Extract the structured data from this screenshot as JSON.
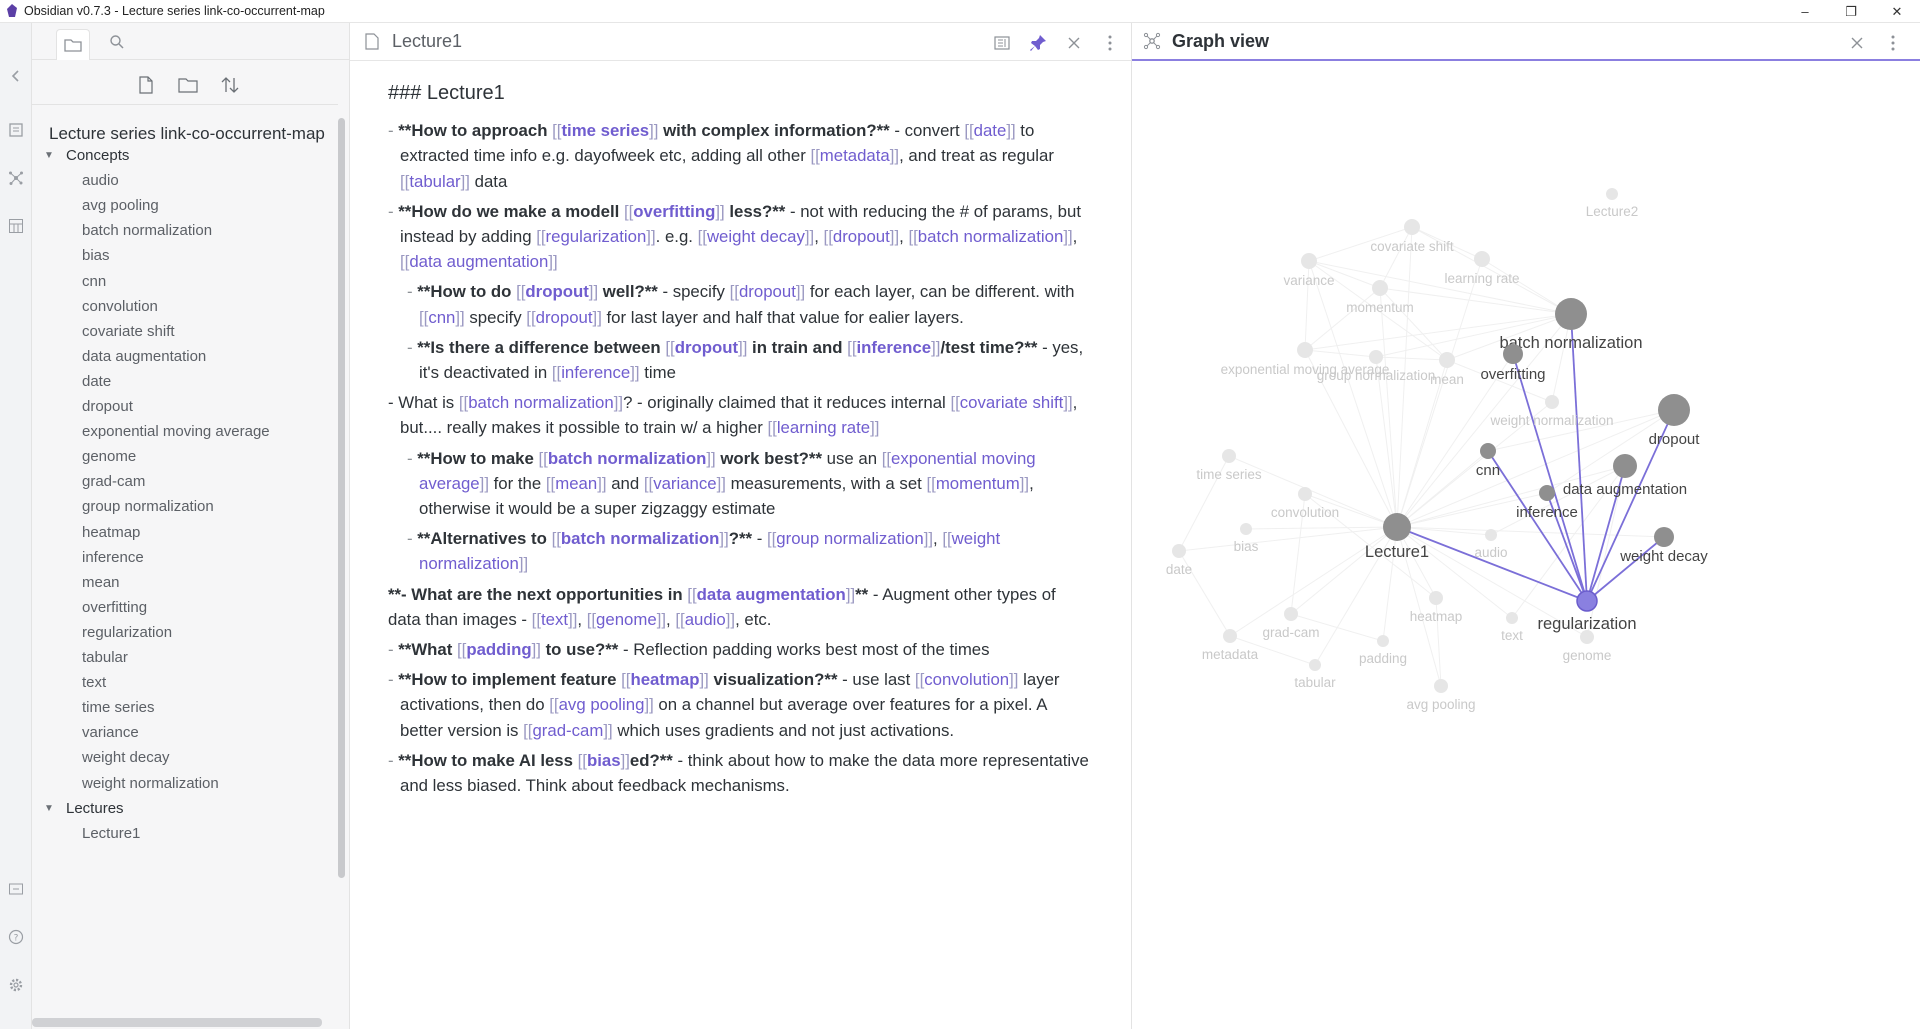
{
  "window": {
    "title": "Obsidian v0.7.3 - Lecture series link-co-occurrent-map",
    "controls": {
      "minimize": "–",
      "restore": "❐",
      "close": "✕"
    }
  },
  "ribbon": {
    "icons": [
      "collapse-icon",
      "open-quick-switcher-icon",
      "graph-icon",
      "templates-icon",
      "import-icon",
      "help-icon",
      "settings-icon"
    ]
  },
  "sidebar": {
    "tabs": [
      "file-explorer-icon",
      "search-icon"
    ],
    "actions": [
      "new-note-icon",
      "new-folder-icon",
      "sort-icon"
    ],
    "vault_name": "Lecture series link-co-occurrent-map",
    "folders": [
      {
        "name": "Concepts",
        "expanded": true,
        "files": [
          "audio",
          "avg pooling",
          "batch normalization",
          "bias",
          "cnn",
          "convolution",
          "covariate shift",
          "data augmentation",
          "date",
          "dropout",
          "exponential moving average",
          "genome",
          "grad-cam",
          "group normalization",
          "heatmap",
          "inference",
          "mean",
          "overfitting",
          "regularization",
          "tabular",
          "text",
          "time series",
          "variance",
          "weight decay",
          "weight normalization"
        ]
      },
      {
        "name": "Lectures",
        "expanded": true,
        "files": [
          "Lecture1"
        ]
      }
    ]
  },
  "editor": {
    "title": "Lecture1",
    "heading": "### Lecture1",
    "lines": [
      {
        "level": 1,
        "parts": [
          [
            "t",
            "- "
          ],
          [
            "b",
            "**How to approach "
          ],
          [
            "bl",
            "[["
          ],
          [
            "lb",
            "time series"
          ],
          [
            "bl",
            "]]"
          ],
          [
            "b",
            " with complex information?**"
          ],
          [
            "t",
            " - convert "
          ],
          [
            "bl",
            "[["
          ],
          [
            "l",
            "date"
          ],
          [
            "bl",
            "]]"
          ],
          [
            "t",
            " to extracted time info e.g. dayofweek etc, adding all other "
          ],
          [
            "bl",
            "[["
          ],
          [
            "l",
            "metadata"
          ],
          [
            "bl",
            "]]"
          ],
          [
            "t",
            ", and treat as regular "
          ],
          [
            "bl",
            "[["
          ],
          [
            "l",
            "tabular"
          ],
          [
            "bl",
            "]]"
          ],
          [
            "t",
            " data"
          ]
        ]
      },
      {
        "level": 1,
        "parts": [
          [
            "t",
            "- "
          ],
          [
            "b",
            "**How do we make a modell "
          ],
          [
            "bl",
            "[["
          ],
          [
            "lb",
            "overfitting"
          ],
          [
            "bl",
            "]]"
          ],
          [
            "b",
            " less?**"
          ],
          [
            "t",
            " - not with reducing the # of params, but instead by adding "
          ],
          [
            "bl",
            "[["
          ],
          [
            "l",
            "regularization"
          ],
          [
            "bl",
            "]]"
          ],
          [
            "t",
            ". e.g. "
          ],
          [
            "bl",
            "[["
          ],
          [
            "l",
            "weight decay"
          ],
          [
            "bl",
            "]]"
          ],
          [
            "t",
            ", "
          ],
          [
            "bl",
            "[["
          ],
          [
            "l",
            "dropout"
          ],
          [
            "bl",
            "]]"
          ],
          [
            "t",
            ", "
          ],
          [
            "bl",
            "[["
          ],
          [
            "l",
            "batch normalization"
          ],
          [
            "bl",
            "]]"
          ],
          [
            "t",
            ", "
          ],
          [
            "bl",
            "[["
          ],
          [
            "l",
            "data augmentation"
          ],
          [
            "bl",
            "]]"
          ]
        ]
      },
      {
        "level": 2,
        "parts": [
          [
            "t",
            "- "
          ],
          [
            "b",
            "**How to do "
          ],
          [
            "bl",
            "[["
          ],
          [
            "lb",
            "dropout"
          ],
          [
            "bl",
            "]]"
          ],
          [
            "b",
            " well?**"
          ],
          [
            "t",
            " - specify "
          ],
          [
            "bl",
            "[["
          ],
          [
            "l",
            "dropout"
          ],
          [
            "bl",
            "]]"
          ],
          [
            "t",
            " for each layer, can be different. with "
          ],
          [
            "bl",
            "[["
          ],
          [
            "l",
            "cnn"
          ],
          [
            "bl",
            "]]"
          ],
          [
            "t",
            " specify "
          ],
          [
            "bl",
            "[["
          ],
          [
            "l",
            "dropout"
          ],
          [
            "bl",
            "]]"
          ],
          [
            "t",
            " for last layer and half that value for ealier layers."
          ]
        ]
      },
      {
        "level": 2,
        "parts": [
          [
            "t",
            "- "
          ],
          [
            "b",
            "**Is there a difference between "
          ],
          [
            "bl",
            "[["
          ],
          [
            "lb",
            "dropout"
          ],
          [
            "bl",
            "]]"
          ],
          [
            "b",
            " in train and "
          ],
          [
            "bl",
            "[["
          ],
          [
            "lb",
            "inference"
          ],
          [
            "bl",
            "]]"
          ],
          [
            "b",
            "/test time?**"
          ],
          [
            "t",
            " - yes, it's deactivated in "
          ],
          [
            "bl",
            "[["
          ],
          [
            "l",
            "inference"
          ],
          [
            "bl",
            "]]"
          ],
          [
            "t",
            " time"
          ]
        ]
      },
      {
        "level": 1,
        "parts": [
          [
            "t",
            "- What is "
          ],
          [
            "bl",
            "[["
          ],
          [
            "l",
            "batch normalization"
          ],
          [
            "bl",
            "]]"
          ],
          [
            "t",
            "? - originally claimed that it reduces internal "
          ],
          [
            "bl",
            "[["
          ],
          [
            "l",
            "covariate shift"
          ],
          [
            "bl",
            "]]"
          ],
          [
            "t",
            ", but.... really makes it possible to train w/ a higher "
          ],
          [
            "bl",
            "[["
          ],
          [
            "l",
            "learning rate"
          ],
          [
            "bl",
            "]]"
          ]
        ]
      },
      {
        "level": 2,
        "parts": [
          [
            "t",
            "- "
          ],
          [
            "b",
            "**How to make "
          ],
          [
            "bl",
            "[["
          ],
          [
            "lb",
            "batch normalization"
          ],
          [
            "bl",
            "]]"
          ],
          [
            "b",
            " work best?**"
          ],
          [
            "t",
            " use an "
          ],
          [
            "bl",
            "[["
          ],
          [
            "l",
            "exponential moving average"
          ],
          [
            "bl",
            "]]"
          ],
          [
            "t",
            " for the "
          ],
          [
            "bl",
            "[["
          ],
          [
            "l",
            "mean"
          ],
          [
            "bl",
            "]]"
          ],
          [
            "t",
            " and "
          ],
          [
            "bl",
            "[["
          ],
          [
            "l",
            "variance"
          ],
          [
            "bl",
            "]]"
          ],
          [
            "t",
            " measurements, with a set "
          ],
          [
            "bl",
            "[["
          ],
          [
            "l",
            "momentum"
          ],
          [
            "bl",
            "]]"
          ],
          [
            "t",
            ", otherwise it would be a super zigzaggy estimate"
          ]
        ]
      },
      {
        "level": 2,
        "parts": [
          [
            "t",
            "- "
          ],
          [
            "b",
            "**Alternatives to "
          ],
          [
            "bl",
            "[["
          ],
          [
            "lb",
            "batch normalization"
          ],
          [
            "bl",
            "]]"
          ],
          [
            "b",
            "?**"
          ],
          [
            "t",
            " - "
          ],
          [
            "bl",
            "[["
          ],
          [
            "l",
            "group normalization"
          ],
          [
            "bl",
            "]]"
          ],
          [
            "t",
            ", "
          ],
          [
            "bl",
            "[["
          ],
          [
            "l",
            "weight normalization"
          ],
          [
            "bl",
            "]]"
          ]
        ]
      },
      {
        "level": 0,
        "parts": [
          [
            "b",
            "**- What are the next opportunities in "
          ],
          [
            "bl",
            "[["
          ],
          [
            "lb",
            "data augmentation"
          ],
          [
            "bl",
            "]]"
          ],
          [
            "b",
            "**"
          ],
          [
            "t",
            " - Augment other types of data than images - "
          ],
          [
            "bl",
            "[["
          ],
          [
            "l",
            "text"
          ],
          [
            "bl",
            "]]"
          ],
          [
            "t",
            ", "
          ],
          [
            "bl",
            "[["
          ],
          [
            "l",
            "genome"
          ],
          [
            "bl",
            "]]"
          ],
          [
            "t",
            ", "
          ],
          [
            "bl",
            "[["
          ],
          [
            "l",
            "audio"
          ],
          [
            "bl",
            "]]"
          ],
          [
            "t",
            ", etc."
          ]
        ]
      },
      {
        "level": 1,
        "parts": [
          [
            "t",
            "- "
          ],
          [
            "b",
            "**What "
          ],
          [
            "bl",
            "[["
          ],
          [
            "lb",
            "padding"
          ],
          [
            "bl",
            "]]"
          ],
          [
            "b",
            " to use?**"
          ],
          [
            "t",
            " - Reflection padding works best most of the times"
          ]
        ]
      },
      {
        "level": 1,
        "parts": [
          [
            "t",
            "- "
          ],
          [
            "b",
            "**How to implement feature "
          ],
          [
            "bl",
            "[["
          ],
          [
            "lb",
            "heatmap"
          ],
          [
            "bl",
            "]]"
          ],
          [
            "b",
            " visualization?**"
          ],
          [
            "t",
            " - use last "
          ],
          [
            "bl",
            "[["
          ],
          [
            "l",
            "convolution"
          ],
          [
            "bl",
            "]]"
          ],
          [
            "t",
            " layer activations, then do "
          ],
          [
            "bl",
            "[["
          ],
          [
            "l",
            "avg pooling"
          ],
          [
            "bl",
            "]]"
          ],
          [
            "t",
            " on a channel but average over features for a pixel. A better version is "
          ],
          [
            "bl",
            "[["
          ],
          [
            "l",
            "grad-cam"
          ],
          [
            "bl",
            "]]"
          ],
          [
            "t",
            " which uses gradients and not just activations."
          ]
        ]
      },
      {
        "level": 1,
        "parts": [
          [
            "t",
            "- "
          ],
          [
            "b",
            "**How to make AI less "
          ],
          [
            "bl",
            "[["
          ],
          [
            "lb",
            "bias"
          ],
          [
            "bl",
            "]]"
          ],
          [
            "b",
            "ed?**"
          ],
          [
            "t",
            " - think about how to make the data more representative and less biased. Think about feedback mechanisms."
          ]
        ]
      }
    ],
    "actions": [
      "preview-toggle-icon",
      "pin-icon",
      "close-icon",
      "more-options-icon"
    ]
  },
  "graph": {
    "title": "Graph view",
    "actions": [
      "close-icon",
      "more-options-icon"
    ],
    "colors": {
      "highlight": "#7b6fd8",
      "active_node": "#8a80e0",
      "node": "#8f8f8f",
      "faded_node": "#e6e6e6",
      "faded_edge": "#f0f0f0",
      "label": "#444444",
      "faded_label": "#c9c9c9"
    },
    "nodes": [
      {
        "id": "regularization",
        "label": "regularization",
        "state": "active"
      },
      {
        "id": "Lecture1",
        "label": "Lecture1",
        "state": "neighbor"
      },
      {
        "id": "batch normalization",
        "label": "batch normalization",
        "state": "neighbor"
      },
      {
        "id": "dropout",
        "label": "dropout",
        "state": "neighbor"
      },
      {
        "id": "overfitting",
        "label": "overfitting",
        "state": "neighbor"
      },
      {
        "id": "data augmentation",
        "label": "data augmentation",
        "state": "neighbor"
      },
      {
        "id": "weight decay",
        "label": "weight decay",
        "state": "neighbor"
      },
      {
        "id": "cnn",
        "label": "cnn",
        "state": "neighbor"
      },
      {
        "id": "inference",
        "label": "inference",
        "state": "neighbor"
      },
      {
        "id": "Lecture2",
        "label": "Lecture2",
        "state": "faded"
      },
      {
        "id": "covariate shift",
        "label": "covariate shift",
        "state": "faded"
      },
      {
        "id": "learning rate",
        "label": "learning rate",
        "state": "faded"
      },
      {
        "id": "variance",
        "label": "variance",
        "state": "faded"
      },
      {
        "id": "momentum",
        "label": "momentum",
        "state": "faded"
      },
      {
        "id": "exponential moving average",
        "label": "exponential moving average",
        "state": "faded"
      },
      {
        "id": "group normalization",
        "label": "group normalization",
        "state": "faded"
      },
      {
        "id": "mean",
        "label": "mean",
        "state": "faded"
      },
      {
        "id": "weight normalization",
        "label": "weight normalization",
        "state": "faded"
      },
      {
        "id": "time series",
        "label": "time series",
        "state": "faded"
      },
      {
        "id": "convolution",
        "label": "convolution",
        "state": "faded"
      },
      {
        "id": "audio",
        "label": "audio",
        "state": "faded"
      },
      {
        "id": "bias",
        "label": "bias",
        "state": "faded"
      },
      {
        "id": "date",
        "label": "date",
        "state": "faded"
      },
      {
        "id": "grad-cam",
        "label": "grad-cam",
        "state": "faded"
      },
      {
        "id": "heatmap",
        "label": "heatmap",
        "state": "faded"
      },
      {
        "id": "text",
        "label": "text",
        "state": "faded"
      },
      {
        "id": "genome",
        "label": "genome",
        "state": "faded"
      },
      {
        "id": "metadata",
        "label": "metadata",
        "state": "faded"
      },
      {
        "id": "padding",
        "label": "padding",
        "state": "faded"
      },
      {
        "id": "tabular",
        "label": "tabular",
        "state": "faded"
      },
      {
        "id": "avg pooling",
        "label": "avg pooling",
        "state": "faded"
      }
    ]
  }
}
